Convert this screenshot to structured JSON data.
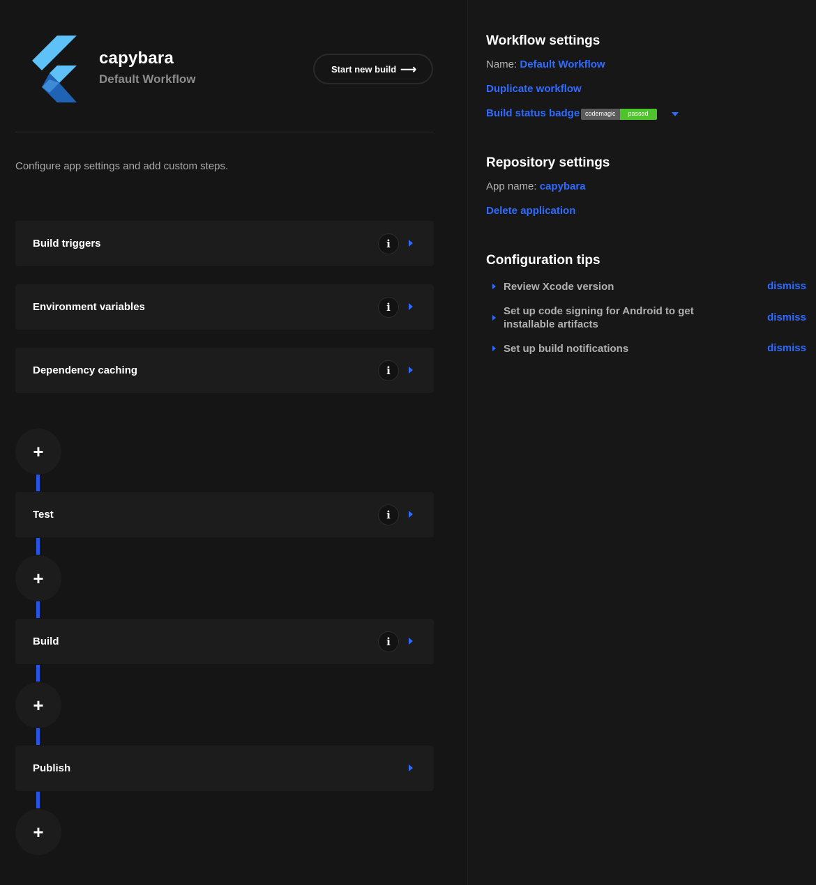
{
  "header": {
    "app_name": "capybara",
    "workflow_name": "Default Workflow",
    "start_build_label": "Start new build",
    "start_build_icon": "arrow-right-icon"
  },
  "description": "Configure app settings and add custom steps.",
  "sections": [
    {
      "label": "Build triggers",
      "has_info": true
    },
    {
      "label": "Environment variables",
      "has_info": true
    },
    {
      "label": "Dependency caching",
      "has_info": true
    }
  ],
  "steps": [
    {
      "label": "Test",
      "has_info": true
    },
    {
      "label": "Build",
      "has_info": true
    },
    {
      "label": "Publish",
      "has_info": false
    }
  ],
  "add_step_symbol": "+",
  "info_symbol": "i",
  "workflow_settings": {
    "title": "Workflow settings",
    "name_label": "Name:",
    "name_value": "Default Workflow",
    "duplicate_label": "Duplicate workflow",
    "badge_label": "Build status badge",
    "badge_left": "codemagic",
    "badge_right": "passed"
  },
  "repository_settings": {
    "title": "Repository settings",
    "app_name_label": "App name:",
    "app_name_value": "capybara",
    "delete_label": "Delete application"
  },
  "configuration_tips": {
    "title": "Configuration tips",
    "dismiss_label": "dismiss",
    "tips": [
      "Review Xcode version",
      "Set up code signing for Android to get installable artifacts",
      "Set up build notifications"
    ]
  },
  "colors": {
    "background": "#151515",
    "card": "#1c1c1c",
    "accent_blue": "#2f6bff",
    "badge_green": "#4fc32b",
    "flutter_light": "#5ec2f9",
    "flutter_dark": "#1f63b5"
  }
}
